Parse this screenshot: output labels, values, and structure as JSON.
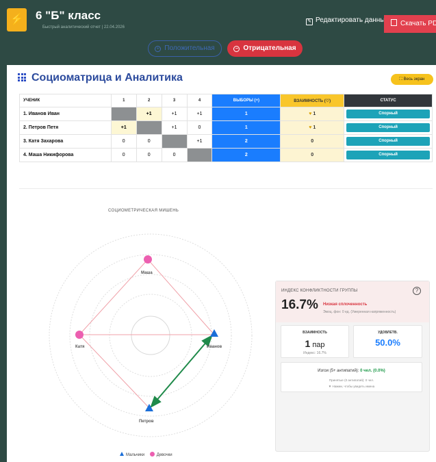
{
  "header": {
    "logo_glyph": "⚡",
    "title": "6 \"Б\" класс",
    "subtitle": "Быстрый аналитический отчет | 22.04.2026",
    "edit_label": "Редактировать данные",
    "pdf_label": "Скачать PDF"
  },
  "modes": {
    "positive": "Положительная",
    "negative": "Отрицательная",
    "active": "negative"
  },
  "section": {
    "title": "Социоматрица и Аналитика",
    "fullscreen": "Весь экран"
  },
  "table": {
    "headers": {
      "student": "УЧЕНИК",
      "cols": [
        "1",
        "2",
        "3",
        "4"
      ],
      "choices": "ВЫБОРЫ (+)",
      "mutual": "ВЗАИМНОСТЬ (♡)",
      "status": "СТАТУС"
    },
    "rows": [
      {
        "name": "1. Иванов Иван",
        "cells": [
          "",
          "+1",
          "+1",
          "+1"
        ],
        "choices": "1",
        "mutual": "1",
        "status": "Спорный"
      },
      {
        "name": "2. Петров Петя",
        "cells": [
          "+1",
          "",
          "+1",
          "0"
        ],
        "choices": "1",
        "mutual": "1",
        "status": "Спорный"
      },
      {
        "name": "3. Катя Захарова",
        "cells": [
          "0",
          "0",
          "",
          "+1"
        ],
        "choices": "2",
        "mutual": "0",
        "status": "Спорный"
      },
      {
        "name": "4. Маша Никифорова",
        "cells": [
          "0",
          "0",
          "0",
          ""
        ],
        "choices": "2",
        "mutual": "0",
        "status": "Спорный"
      }
    ]
  },
  "target": {
    "title": "СОЦИОМЕТРИЧЕСКАЯ МИШЕНЬ",
    "nodes": {
      "masha": "Маша",
      "katya": "Катя",
      "ivanov": "Иванов",
      "petrov": "Петров"
    },
    "legend": {
      "boys": "Мальчики",
      "girls": "Девочки"
    },
    "colors": {
      "boys": "#1a6ed8",
      "girls": "#ec5fb0",
      "link": "#f0a0a8",
      "mutual": "#1f8a4a"
    }
  },
  "stats": {
    "index_label": "ИНДЕКС КОНФЛИКТНОСТИ ГРУППЫ",
    "index_value": "16.7%",
    "index_status": "Низкая сплоченность",
    "index_note": "Эмоц. фон: 0 ед. (Умеренная напряженность)",
    "mutual_label": "ВЗАИМНОСТЬ",
    "mutual_value": "1",
    "mutual_unit": "пар",
    "mutual_index": "Индекс: 16.7%",
    "satisfaction_label": "УДОВЛЕТВ.",
    "satisfaction_value": "50.0%",
    "outcasts_label": "Изгои (5+ антипатий):",
    "outcasts_value": "0 чел. (0.0%)",
    "accepted": "Принятые (0 антипатий): 0 чел.",
    "hint": "▼ Нажми, чтобы увидеть имена"
  }
}
